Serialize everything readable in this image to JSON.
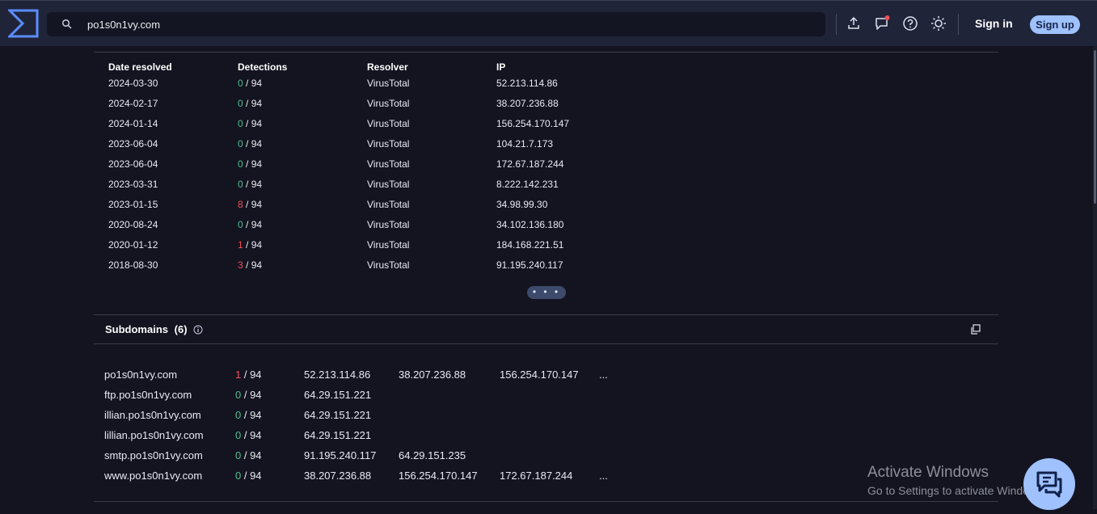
{
  "search": {
    "value": "po1s0n1vy.com"
  },
  "header": {
    "signin_label": "Sign in",
    "signup_label": "Sign up"
  },
  "resolutions": {
    "columns": [
      "Date resolved",
      "Detections",
      "Resolver",
      "IP"
    ],
    "rows": [
      {
        "date": "2024-03-30",
        "det": "0",
        "total": " / 94",
        "resolver": "VirusTotal",
        "ip": "52.213.114.86",
        "status": "clean"
      },
      {
        "date": "2024-02-17",
        "det": "0",
        "total": " / 94",
        "resolver": "VirusTotal",
        "ip": "38.207.236.88",
        "status": "clean"
      },
      {
        "date": "2024-01-14",
        "det": "0",
        "total": " / 94",
        "resolver": "VirusTotal",
        "ip": "156.254.170.147",
        "status": "clean"
      },
      {
        "date": "2023-06-04",
        "det": "0",
        "total": " / 94",
        "resolver": "VirusTotal",
        "ip": "104.21.7.173",
        "status": "clean"
      },
      {
        "date": "2023-06-04",
        "det": "0",
        "total": " / 94",
        "resolver": "VirusTotal",
        "ip": "172.67.187.244",
        "status": "clean"
      },
      {
        "date": "2023-03-31",
        "det": "0",
        "total": " / 94",
        "resolver": "VirusTotal",
        "ip": "8.222.142.231",
        "status": "clean"
      },
      {
        "date": "2023-01-15",
        "det": "8",
        "total": " / 94",
        "resolver": "VirusTotal",
        "ip": "34.98.99.30",
        "status": "malicious"
      },
      {
        "date": "2020-08-24",
        "det": "0",
        "total": " / 94",
        "resolver": "VirusTotal",
        "ip": "34.102.136.180",
        "status": "clean"
      },
      {
        "date": "2020-01-12",
        "det": "1",
        "total": " / 94",
        "resolver": "VirusTotal",
        "ip": "184.168.221.51",
        "status": "malicious"
      },
      {
        "date": "2018-08-30",
        "det": "3",
        "total": " / 94",
        "resolver": "VirusTotal",
        "ip": "91.195.240.117",
        "status": "malicious"
      }
    ],
    "more_label": "• • •"
  },
  "subdomains": {
    "title": "Subdomains",
    "count": "(6)",
    "rows": [
      {
        "name": "po1s0n1vy.com",
        "det": "1",
        "total": " / 94",
        "status": "malicious",
        "ips": [
          "52.213.114.86",
          "38.207.236.88",
          "156.254.170.147"
        ],
        "more": "..."
      },
      {
        "name": "ftp.po1s0n1vy.com",
        "det": "0",
        "total": " / 94",
        "status": "clean",
        "ips": [
          "64.29.151.221"
        ],
        "more": ""
      },
      {
        "name": "illian.po1s0n1vy.com",
        "det": "0",
        "total": " / 94",
        "status": "clean",
        "ips": [
          "64.29.151.221"
        ],
        "more": ""
      },
      {
        "name": "lillian.po1s0n1vy.com",
        "det": "0",
        "total": " / 94",
        "status": "clean",
        "ips": [
          "64.29.151.221"
        ],
        "more": ""
      },
      {
        "name": "smtp.po1s0n1vy.com",
        "det": "0",
        "total": " / 94",
        "status": "clean",
        "ips": [
          "91.195.240.117",
          "64.29.151.235"
        ],
        "more": ""
      },
      {
        "name": "www.po1s0n1vy.com",
        "det": "0",
        "total": " / 94",
        "status": "clean",
        "ips": [
          "38.207.236.88",
          "156.254.170.147",
          "172.67.187.244"
        ],
        "more": "..."
      }
    ]
  },
  "watermark": {
    "line1": "Activate Windows",
    "line2": "Go to Settings to activate Windows."
  },
  "colors": {
    "clean": "#4fbf8e",
    "malicious": "#f0505a",
    "accent": "#9fc2ff"
  }
}
